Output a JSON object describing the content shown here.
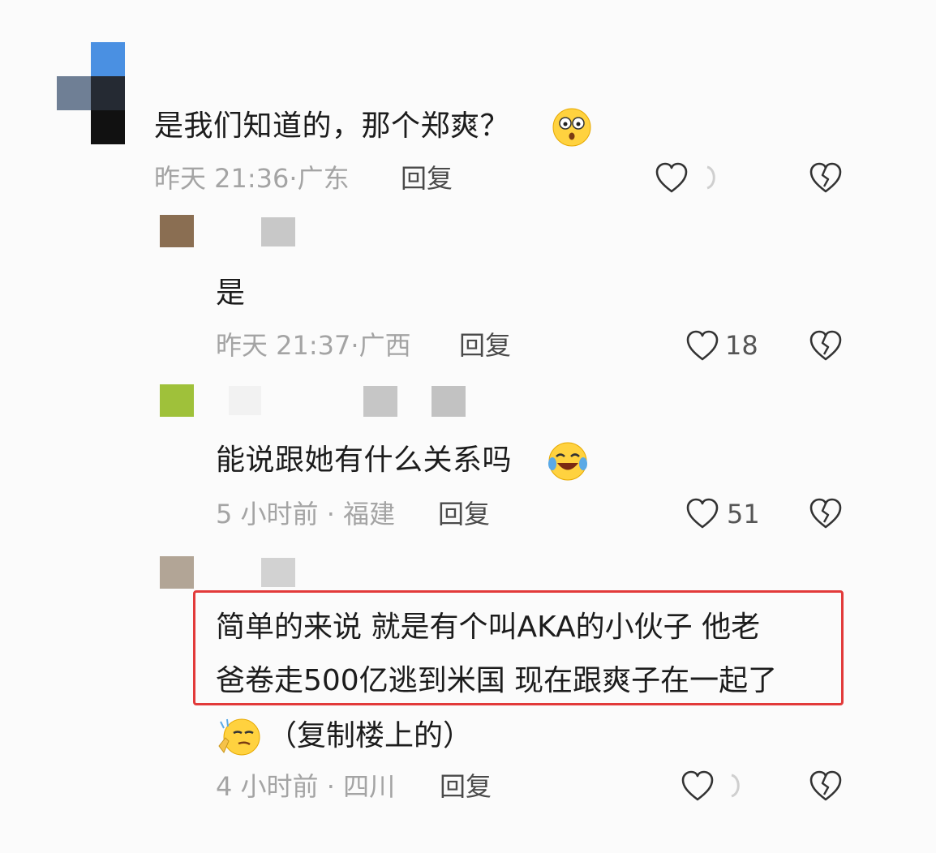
{
  "comments": [
    {
      "text": "是我们知道的，那个郑爽？",
      "emoji": "thinking-face-emoji",
      "time": "昨天 21:36",
      "location": "广东",
      "reply_label": "回复",
      "likes": ""
    },
    {
      "text": "是",
      "time": "昨天 21:37",
      "location": "广西",
      "reply_label": "回复",
      "likes": "18"
    },
    {
      "text": "能说跟她有什么关系吗",
      "emoji": "laughing-tears-emoji",
      "time": "5 小时前",
      "location": "福建",
      "reply_label": "回复",
      "likes": "51"
    },
    {
      "text_line1": "简单的来说 就是有个叫AKA的小伙子 他老",
      "text_line2": "爸卷走500亿逃到米国 现在跟爽子在一起了",
      "text_line3": "（复制楼上的）",
      "emoji": "smirk-face-emoji",
      "time": "4 小时前",
      "location": "四川",
      "reply_label": "回复",
      "likes": ""
    }
  ],
  "separator": "·",
  "colors": {
    "highlight": "#e23a3a",
    "meta_text": "#a4a4a4"
  }
}
